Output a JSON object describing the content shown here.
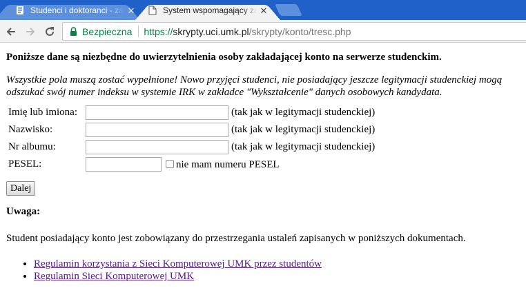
{
  "browser": {
    "tabs": [
      {
        "title": "Studenci i doktoranci - zasoby",
        "favicon": "document-blue-icon",
        "active": false
      },
      {
        "title": "System wspomagający zakładanie kont",
        "favicon": "page-icon",
        "active": true
      }
    ],
    "close_glyph": "✕",
    "address": {
      "security_label": "Bezpieczna",
      "scheme": "https://",
      "host": "skrypty.uci.umk.pl",
      "path": "/skrypty/konto/tresc.php"
    },
    "colors": {
      "tabstrip": "#1f61c8",
      "secure_green": "#0b8043"
    }
  },
  "page": {
    "intro_bold": "Poniższe dane są niezbędne do uwierzytelnienia osoby zakładającej konto na serwerze studenckim.",
    "intro_italic": "Wszystkie pola muszą zostać wypełnione! Nowo przyjęci studenci, nie posiadający jeszcze legitymacji studenckiej mogą odszukać swój numer indeksu w systemie IRK w zakładce \"Wykształcenie\" danych osobowych kandydata.",
    "form": {
      "first_name_label": "Imię lub imiona:",
      "first_name_hint": "(tak jak w legitymacji studenckiej)",
      "first_name_value": "",
      "last_name_label": "Nazwisko:",
      "last_name_hint": "(tak jak w legitymacji studenckiej)",
      "last_name_value": "",
      "album_label": "Nr albumu:",
      "album_hint": "(tak jak w legitymacji studenckiej)",
      "album_value": "",
      "pesel_label": "PESEL:",
      "pesel_value": "",
      "no_pesel_label": "nie mam numeru PESEL",
      "no_pesel_checked": false,
      "submit_label": "Dalej"
    },
    "warning_title": "Uwaga:",
    "warning_text": "Student posiadający konto jest zobowiązany do przestrzegania ustaleń zapisanych w poniższych dokumentach.",
    "documents": [
      "Regulamin korzystania z Sieci Komputerowej UMK przez studentów",
      "Regulamin Sieci Komputerowej UMK"
    ]
  }
}
